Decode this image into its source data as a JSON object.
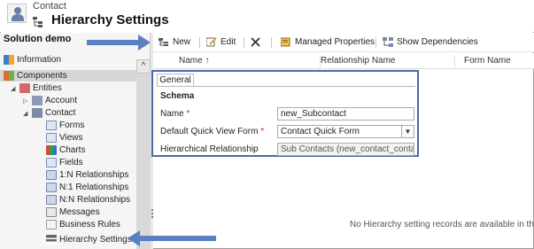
{
  "header": {
    "breadcrumb": "Contact",
    "title": "Hierarchy Settings"
  },
  "sidebar": {
    "solution_title": "Solution demo",
    "items": [
      {
        "label": "Information",
        "icon": "information-icon"
      },
      {
        "label": "Components",
        "icon": "components-icon"
      },
      {
        "label": "Entities",
        "icon": "entities-icon"
      },
      {
        "label": "Account",
        "icon": "account-icon"
      },
      {
        "label": "Contact",
        "icon": "contact-icon"
      },
      {
        "label": "Forms",
        "icon": "forms-icon"
      },
      {
        "label": "Views",
        "icon": "views-icon"
      },
      {
        "label": "Charts",
        "icon": "charts-icon"
      },
      {
        "label": "Fields",
        "icon": "fields-icon"
      },
      {
        "label": "1:N Relationships",
        "icon": "one-to-many-icon"
      },
      {
        "label": "N:1 Relationships",
        "icon": "many-to-one-icon"
      },
      {
        "label": "N:N Relationships",
        "icon": "many-to-many-icon"
      },
      {
        "label": "Messages",
        "icon": "messages-icon"
      },
      {
        "label": "Business Rules",
        "icon": "business-rules-icon"
      },
      {
        "label": "Hierarchy Settings",
        "icon": "hierarchy-icon"
      }
    ],
    "scroll_up": "^"
  },
  "toolbar": {
    "new_label": "New",
    "edit_label": "Edit",
    "managed_properties_label": "Managed Properties",
    "show_dependencies_label": "Show Dependencies"
  },
  "grid": {
    "columns": [
      "Name ↑",
      "Relationship Name",
      "Form Name"
    ],
    "empty_message": "No Hierarchy setting records are available in this view"
  },
  "form": {
    "tab_label": "General",
    "section_title": "Schema",
    "name_label": "Name",
    "name_value": "new_Subcontact",
    "quick_view_label": "Default Quick View Form",
    "quick_view_value": "Contact Quick Form",
    "relationship_label": "Hierarchical Relationship",
    "relationship_value": "Sub Contacts (new_contact_contact)",
    "required_mark": "*"
  },
  "colors": {
    "accent_border": "#4a6aa5",
    "arrow": "#5b7fbf",
    "required": "#c0282e"
  }
}
